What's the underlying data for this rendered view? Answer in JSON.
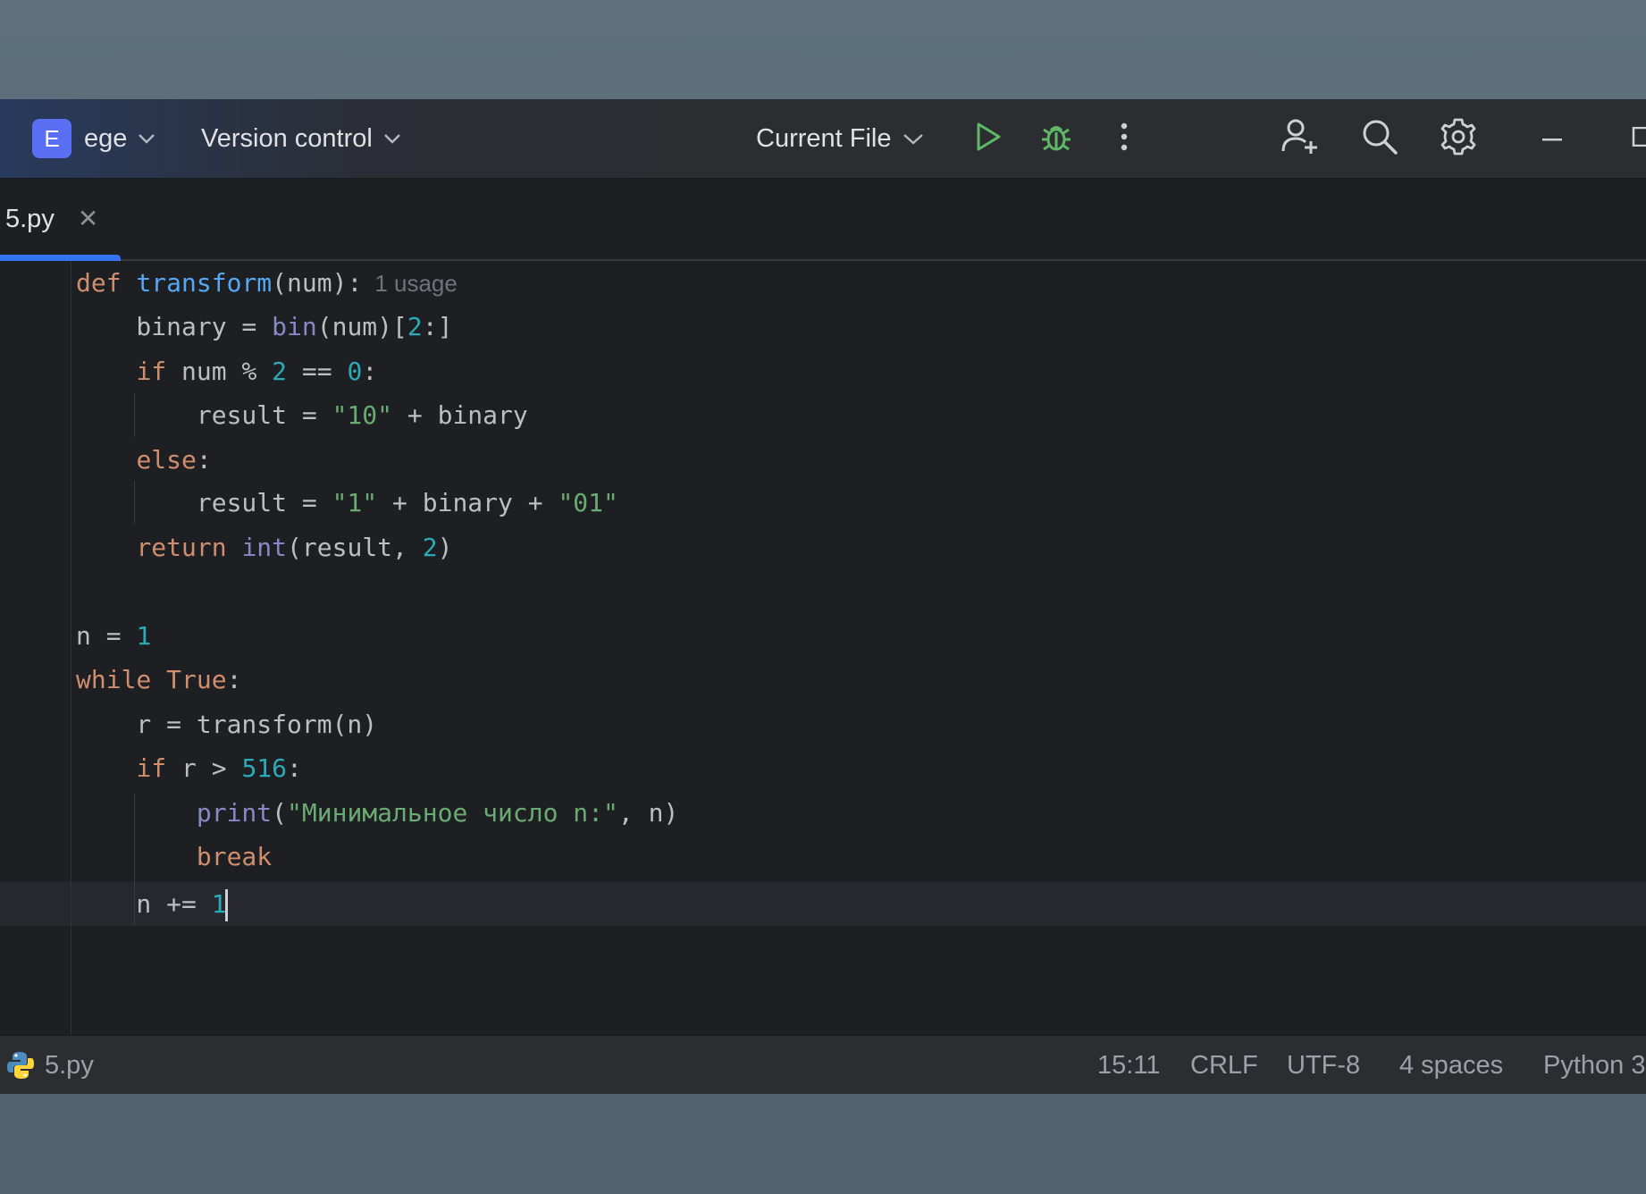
{
  "titlebar": {
    "project_initial": "E",
    "project_name": "ege",
    "vcs_label": "Version control",
    "run_config": "Current File"
  },
  "tabs": [
    {
      "label": "5.py",
      "active": true
    }
  ],
  "editor": {
    "usage_hint": "1 usage",
    "lines": [
      "def transform(num):",
      "    binary = bin(num)[2:]",
      "    if num % 2 == 0:",
      "        result = \"10\" + binary",
      "    else:",
      "        result = \"1\" + binary + \"01\"",
      "    return int(result, 2)",
      "",
      "n = 1",
      "while True:",
      "    r = transform(n)",
      "    if r > 516:",
      "        print(\"Минимальное число n:\", n)",
      "        break",
      "    n += 1"
    ]
  },
  "statusbar": {
    "file": "5.py",
    "position": "15:11",
    "line_ending": "CRLF",
    "encoding": "UTF-8",
    "indent": "4 spaces",
    "interpreter": "Python 3"
  },
  "colors": {
    "keyword": "#cf8e6d",
    "function": "#56a8f5",
    "builtin": "#8888c6",
    "number": "#2aacb8",
    "string": "#6aab73",
    "text": "#bcbec4",
    "accent": "#3574f0",
    "run": "#5fb865"
  },
  "icons": {
    "run": "play-icon",
    "debug": "bug-icon",
    "more": "vertical-dots-icon",
    "collab": "add-user-icon",
    "search": "search-icon",
    "settings": "gear-icon",
    "minimize": "minimize-icon",
    "maximize": "maximize-icon",
    "file_type": "python-icon"
  }
}
